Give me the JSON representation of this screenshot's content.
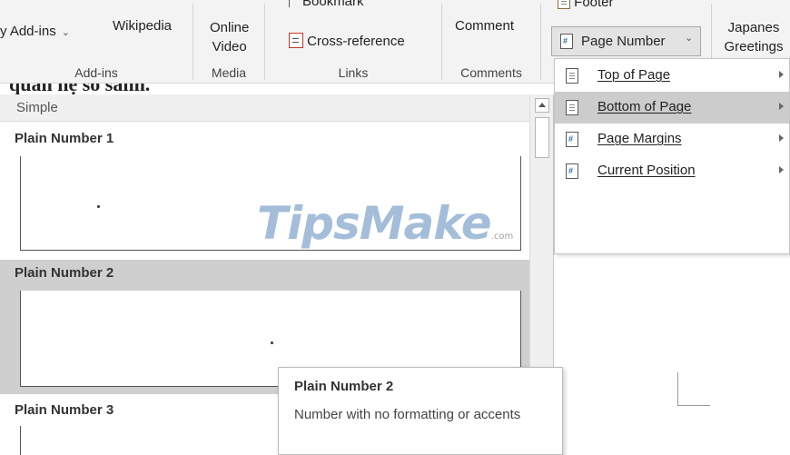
{
  "ribbon": {
    "addins": {
      "my_addins": "y Add-ins",
      "wikipedia": "Wikipedia",
      "group_label": "Add-ins"
    },
    "media": {
      "online_video_line1": "Online",
      "online_video_line2": "Video",
      "group_label": "Media"
    },
    "links": {
      "bookmark": "Bookmark",
      "cross_reference": "Cross-reference",
      "group_label": "Links"
    },
    "comments": {
      "comment": "Comment",
      "group_label": "Comments"
    },
    "header_footer": {
      "footer": "Footer",
      "page_number": "Page Number"
    },
    "japanese": {
      "line1": "Japanes",
      "line2": "Greetings"
    }
  },
  "document": {
    "heading_fragment": "quan hệ so sánh."
  },
  "gallery": {
    "section_header": "Simple",
    "items": [
      {
        "title": "Plain Number 1"
      },
      {
        "title": "Plain Number 2"
      },
      {
        "title": "Plain Number 3"
      }
    ]
  },
  "menu": {
    "items": [
      {
        "label": "Top of Page"
      },
      {
        "label": "Bottom of Page"
      },
      {
        "label": "Page Margins"
      },
      {
        "label": "Current Position"
      }
    ]
  },
  "tooltip": {
    "title": "Plain Number 2",
    "description": "Number with no formatting or accents"
  },
  "watermark": {
    "text": "TipsMake",
    "suffix": ".com"
  },
  "colors": {
    "ribbon_bg": "#f3f3f3",
    "selected_bg": "#cfcfcf",
    "menu_hover": "#cccccc",
    "watermark": "#5a87b9"
  }
}
